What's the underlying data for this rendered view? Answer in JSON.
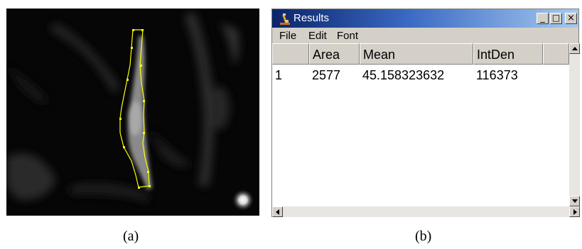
{
  "captions": {
    "a": "(a)",
    "b": "(b)"
  },
  "window": {
    "title": "Results",
    "controls": {
      "minimize": "_",
      "maximize": "□",
      "close": "×"
    }
  },
  "menu": [
    "File",
    "Edit",
    "Font"
  ],
  "table": {
    "columns": [
      "",
      "Area",
      "Mean",
      "IntDen"
    ],
    "rows": [
      [
        "1",
        "2577",
        "45.158323632",
        "116373"
      ]
    ]
  },
  "colors": {
    "roi": "#ffff00",
    "titlebar_start": "#0a246a",
    "titlebar_end": "#a6caf0",
    "chrome": "#d4d0c8"
  },
  "icons": [
    "microscope-icon",
    "scroll-up-icon",
    "scroll-down-icon",
    "scroll-left-icon",
    "scroll-right-icon"
  ]
}
